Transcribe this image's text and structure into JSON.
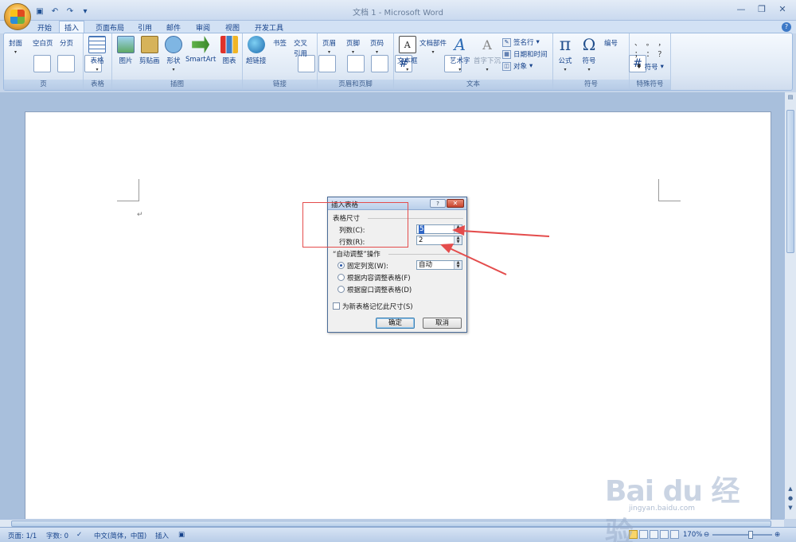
{
  "window": {
    "title": "文档 1 - Microsoft Word"
  },
  "qat": {
    "items": [
      "save-icon",
      "undo-icon",
      "redo-icon",
      "customize-icon"
    ]
  },
  "tabs": [
    {
      "label": "开始",
      "active": false
    },
    {
      "label": "插入",
      "active": true
    },
    {
      "label": "页面布局",
      "active": false
    },
    {
      "label": "引用",
      "active": false
    },
    {
      "label": "邮件",
      "active": false
    },
    {
      "label": "审阅",
      "active": false
    },
    {
      "label": "视图",
      "active": false
    },
    {
      "label": "开发工具",
      "active": false
    }
  ],
  "ribbon": {
    "groups": {
      "pages": {
        "label": "页",
        "buttons": [
          "封面",
          "空白页",
          "分页"
        ]
      },
      "tables": {
        "label": "表格",
        "buttons": [
          "表格"
        ]
      },
      "illustrations": {
        "label": "插图",
        "buttons": [
          "图片",
          "剪贴画",
          "形状",
          "SmartArt",
          "图表"
        ]
      },
      "links": {
        "label": "链接",
        "buttons": [
          "超链接",
          "书签",
          "交叉",
          "引用"
        ]
      },
      "header_footer": {
        "label": "页眉和页脚",
        "buttons": [
          "页眉",
          "页脚",
          "页码"
        ]
      },
      "text": {
        "label": "文本",
        "buttons": [
          "文本框",
          "文档部件",
          "艺术字",
          "首字下沉"
        ],
        "small": [
          "签名行",
          "日期和时间",
          "对象"
        ]
      },
      "symbols": {
        "label": "符号",
        "buttons": [
          "公式",
          "符号",
          "编号"
        ]
      },
      "special": {
        "label": "特殊符号",
        "chars": [
          "、",
          "。",
          "，",
          "；",
          "：",
          "？"
        ],
        "dropdown": "符号"
      }
    }
  },
  "document": {
    "paragraph_mark": "↵"
  },
  "dialog": {
    "title": "插入表格",
    "help": "?",
    "close": "✕",
    "section_size": "表格尺寸",
    "columns_label": "列数(C):",
    "columns_value": "5",
    "rows_label": "行数(R):",
    "rows_value": "2",
    "section_autofit": "“自动调整”操作",
    "fixed_width_label": "固定列宽(W):",
    "fixed_width_value": "自动",
    "autofit_contents_label": "根据内容调整表格(F)",
    "autofit_window_label": "根据窗口调整表格(D)",
    "remember_label": "为新表格记忆此尺寸(S)",
    "ok": "确定",
    "cancel": "取消"
  },
  "statusbar": {
    "page": "页面: 1/1",
    "words": "字数: 0",
    "language": "中文(简体，中国)",
    "mode": "插入",
    "zoom": "170%"
  },
  "watermark": {
    "main": "Bai du 经验",
    "sub": "jingyan.baidu.com"
  },
  "colors": {
    "annotation": "#e44c4c",
    "ribbon_text": "#15428b"
  }
}
